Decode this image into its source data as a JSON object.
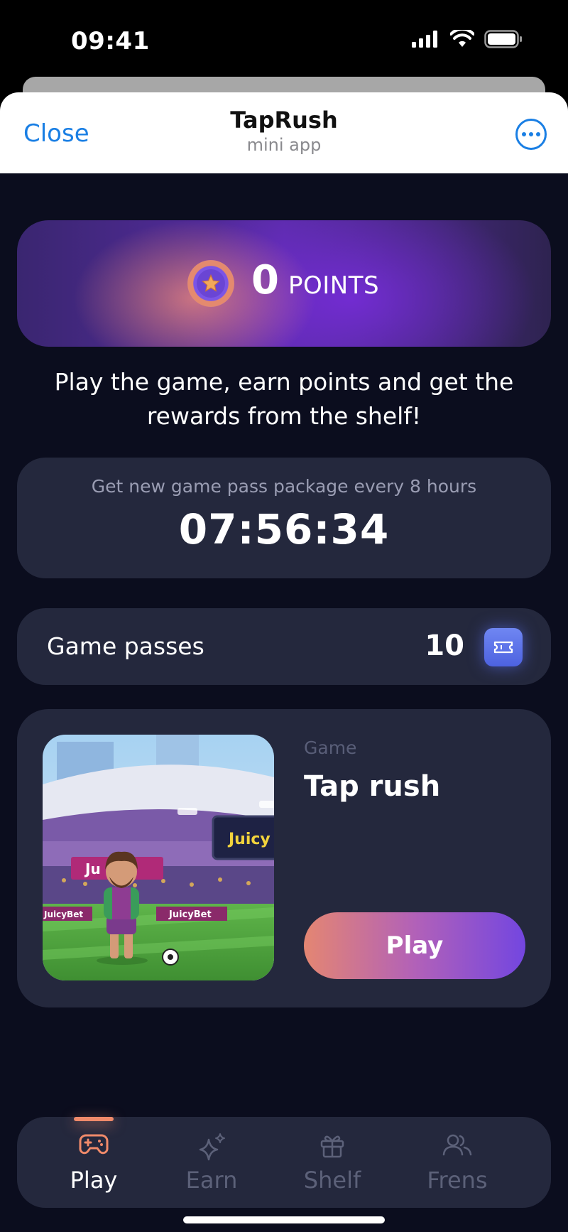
{
  "status_bar": {
    "time": "09:41"
  },
  "header": {
    "close_label": "Close",
    "title": "TapRush",
    "subtitle": "mini app"
  },
  "points": {
    "value": "0",
    "label": "POINTS"
  },
  "intro_text": "Play the game, earn points and get the rewards from the shelf!",
  "timer": {
    "caption": "Get new game pass package every 8 hours",
    "value": "07:56:34"
  },
  "passes": {
    "label": "Game passes",
    "count": "10"
  },
  "game": {
    "kicker": "Game",
    "title": "Tap rush",
    "play_label": "Play",
    "banner_text": "JuicyBet",
    "scoreboard_text": "Juicy"
  },
  "tabs": [
    {
      "label": "Play",
      "icon": "gamepad-icon",
      "active": true
    },
    {
      "label": "Earn",
      "icon": "sparkle-icon",
      "active": false
    },
    {
      "label": "Shelf",
      "icon": "gift-icon",
      "active": false
    },
    {
      "label": "Frens",
      "icon": "friends-icon",
      "active": false
    }
  ],
  "colors": {
    "accent_blue": "#1a7fe4",
    "background": "#0b0d1e",
    "card": "#24283d",
    "active_tab": "#f08a6a",
    "play_gradient_start": "#e48672",
    "play_gradient_end": "#7346e0"
  }
}
